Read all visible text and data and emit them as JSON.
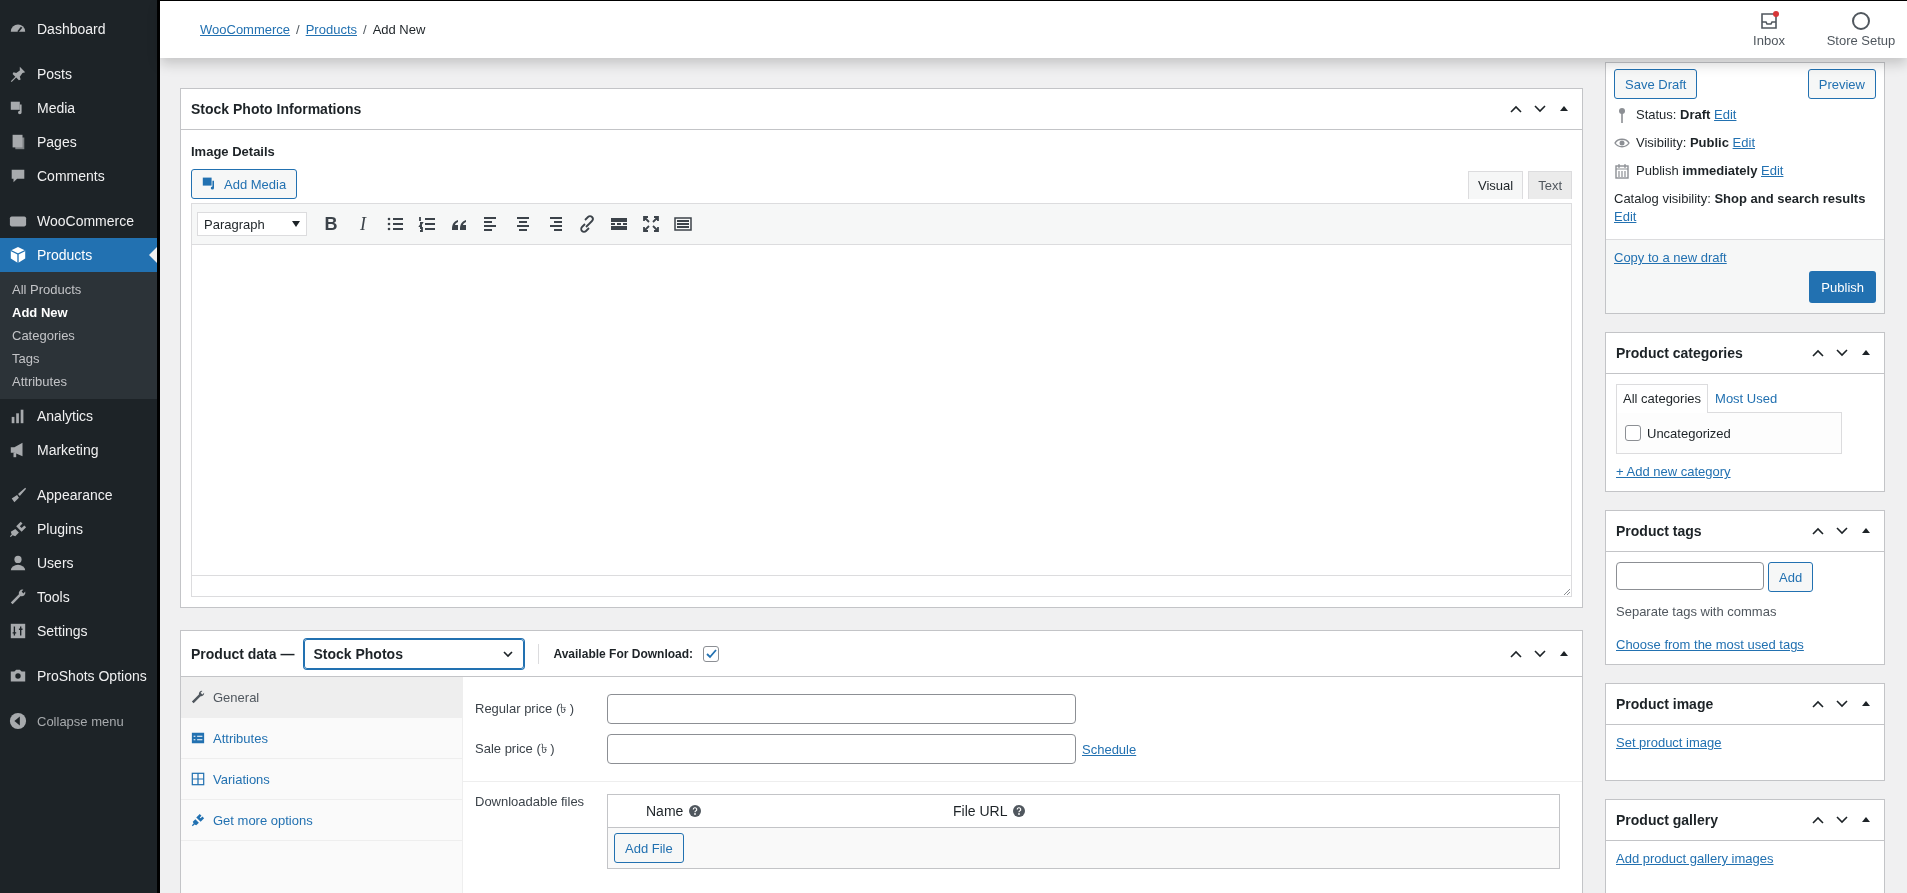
{
  "sidebar": {
    "groups": [
      [
        {
          "label": "Dashboard",
          "selected": false
        }
      ],
      [
        {
          "label": "Posts",
          "selected": false
        },
        {
          "label": "Media",
          "selected": false
        },
        {
          "label": "Pages",
          "selected": false
        },
        {
          "label": "Comments",
          "selected": false
        }
      ],
      [
        {
          "label": "WooCommerce",
          "selected": false
        },
        {
          "label": "Products",
          "selected": true,
          "children": [
            {
              "label": "All Products",
              "selected": false
            },
            {
              "label": "Add New",
              "selected": true
            },
            {
              "label": "Categories",
              "selected": false
            },
            {
              "label": "Tags",
              "selected": false
            },
            {
              "label": "Attributes",
              "selected": false
            }
          ]
        },
        {
          "label": "Analytics",
          "selected": false
        },
        {
          "label": "Marketing",
          "selected": false
        }
      ],
      [
        {
          "label": "Appearance",
          "selected": false
        },
        {
          "label": "Plugins",
          "selected": false
        },
        {
          "label": "Users",
          "selected": false
        },
        {
          "label": "Tools",
          "selected": false
        },
        {
          "label": "Settings",
          "selected": false
        }
      ],
      [
        {
          "label": "ProShots Options",
          "selected": false
        }
      ]
    ],
    "collapse": "Collapse menu"
  },
  "header": {
    "breadcrumbs": [
      {
        "label": "WooCommerce",
        "kind": "link"
      },
      {
        "label": "/",
        "kind": "separator"
      },
      {
        "label": "Products",
        "kind": "link"
      },
      {
        "label": "/",
        "kind": "separator"
      },
      {
        "label": "Add New",
        "kind": "current"
      }
    ],
    "actions": [
      {
        "label": "Inbox",
        "notification": true
      },
      {
        "label": "Store Setup",
        "notification": false
      }
    ]
  },
  "editor_panel": {
    "title": "Stock Photo Informations",
    "section_label": "Image Details",
    "add_media": "Add Media",
    "tabs": [
      {
        "label": "Visual",
        "selected": true
      },
      {
        "label": "Text",
        "selected": false
      }
    ],
    "format_select": "Paragraph",
    "toolbar": [
      {
        "kind": "bold",
        "text": "B"
      },
      {
        "kind": "italic",
        "text": "I"
      },
      {
        "kind": "bullets"
      },
      {
        "kind": "numbers"
      },
      {
        "kind": "quote"
      },
      {
        "kind": "align-left"
      },
      {
        "kind": "align-center"
      },
      {
        "kind": "align-right"
      },
      {
        "kind": "link"
      },
      {
        "kind": "more"
      },
      {
        "kind": "fullscreen"
      },
      {
        "kind": "kitchen-sink"
      }
    ]
  },
  "product_data": {
    "title": "Product data —",
    "type_select": "Stock Photos",
    "download_label": "Available For Download:",
    "download_checked": true,
    "tabs": [
      {
        "label": "General",
        "selected": true
      },
      {
        "label": "Attributes",
        "selected": false
      },
      {
        "label": "Variations",
        "selected": false
      },
      {
        "label": "Get more options",
        "selected": false
      }
    ],
    "fields": [
      {
        "label": "Regular price (৳ )"
      },
      {
        "label": "Sale price (৳ )",
        "link": "Schedule"
      }
    ],
    "downloads": {
      "label": "Downloadable files",
      "columns": [
        "Name",
        "File URL"
      ],
      "add_button": "Add File"
    }
  },
  "publish": {
    "buttons": [
      "Save Draft",
      "Preview"
    ],
    "rows": [
      {
        "text": "Status: **Draft**",
        "link": "Edit"
      },
      {
        "text": "Visibility: **Public**",
        "link": "Edit"
      },
      {
        "text": "Publish **immediately**",
        "link": "Edit"
      },
      {
        "text": "Catalog visibility: **Shop and search results**",
        "link": "Edit"
      }
    ],
    "copy_link": "Copy to a new draft",
    "publish_button": "Publish"
  },
  "categories": {
    "title": "Product categories",
    "tabs": [
      {
        "label": "All categories",
        "selected": true
      },
      {
        "label": "Most Used",
        "selected": false
      }
    ],
    "items": [
      {
        "label": "Uncategorized",
        "checked": false
      }
    ],
    "add_link": "+ Add new category"
  },
  "tags": {
    "title": "Product tags",
    "add_button": "Add",
    "hint": "Separate tags with commas",
    "link": "Choose from the most used tags"
  },
  "image": {
    "title": "Product image",
    "link": "Set product image"
  },
  "gallery": {
    "title": "Product gallery",
    "link": "Add product gallery images"
  }
}
